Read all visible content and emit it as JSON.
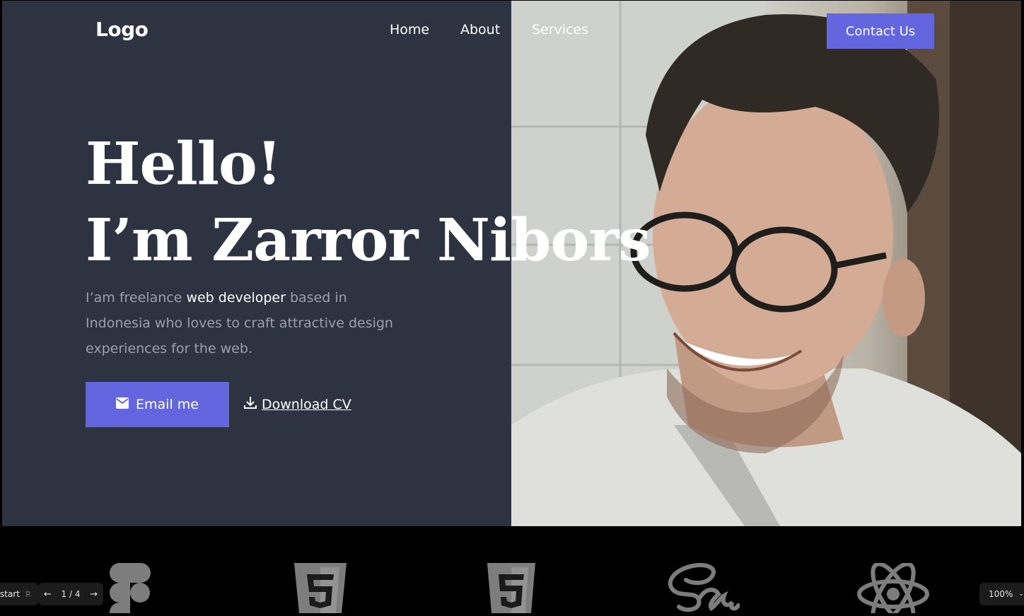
{
  "nav": {
    "logo": "Logo",
    "links": [
      "Home",
      "About",
      "Services"
    ],
    "contact_label": "Contact Us"
  },
  "hero": {
    "line1": "Hello!",
    "line2": "I’m Zarror Nibors",
    "intro_before": "I’am freelance ",
    "intro_highlight": "web developer",
    "intro_after": " based in Indonesia who loves to craft attractive design experiences for the web.",
    "email_label": "Email me",
    "download_label": "Download CV"
  },
  "tech_logos": [
    "figma-icon",
    "html5-icon",
    "css3-icon",
    "sass-icon",
    "react-icon"
  ],
  "viewer": {
    "start_label": "start",
    "start_key": "R",
    "page_indicator": "1 / 4",
    "zoom_label": "100%"
  },
  "colors": {
    "background": "#2d3340",
    "accent": "#6466e0",
    "text": "#ffffff",
    "muted_text": "#9aa0ab"
  }
}
